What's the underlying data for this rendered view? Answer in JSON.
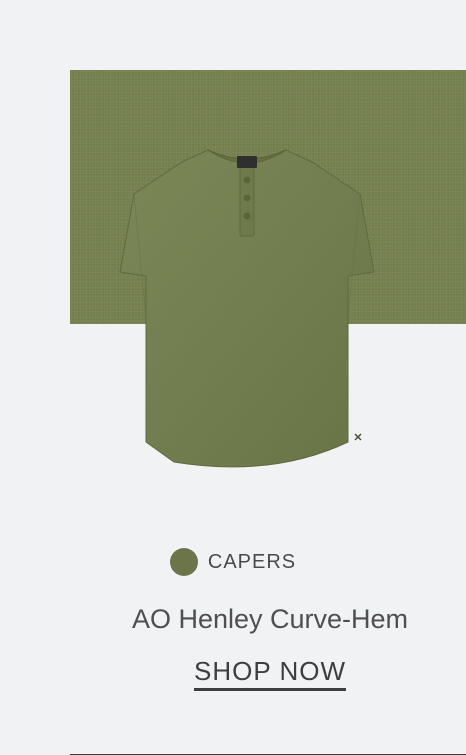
{
  "product": {
    "color_label": "CAPERS",
    "name": "AO Henley Curve-Hem",
    "cta": "SHOP NOW",
    "swatch_color": "#6b7549",
    "background_swatch_color": "#75804f",
    "image_icon": "henley-tshirt-icon"
  }
}
